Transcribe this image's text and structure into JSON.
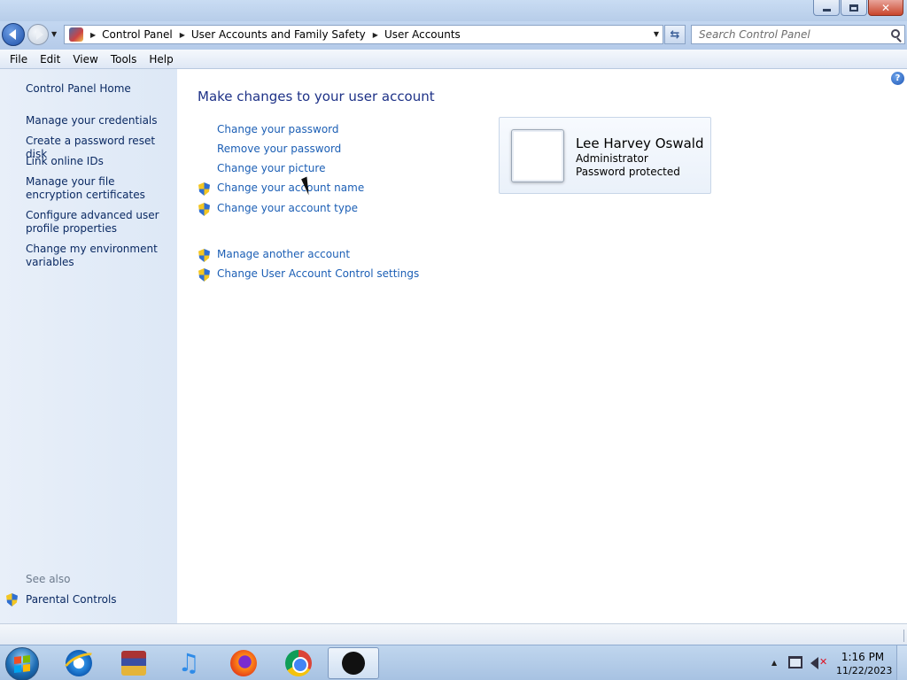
{
  "address": {
    "breadcrumbs": [
      "Control Panel",
      "User Accounts and Family Safety",
      "User Accounts"
    ]
  },
  "search": {
    "placeholder": "Search Control Panel"
  },
  "menu": [
    "File",
    "Edit",
    "View",
    "Tools",
    "Help"
  ],
  "sidebar": {
    "home": "Control Panel Home",
    "links": [
      "Manage your credentials",
      "Create a password reset disk",
      "Link online IDs",
      "Manage your file encryption certificates",
      "Configure advanced user profile properties",
      "Change my environment variables"
    ],
    "see_also": "See also",
    "parental_controls": "Parental Controls"
  },
  "main": {
    "title": "Make changes to your user account",
    "tasks": [
      "Change your password",
      "Remove your password",
      "Change your picture",
      "Change your account name",
      "Change your account type"
    ],
    "other_tasks": [
      "Manage another account",
      "Change User Account Control settings"
    ]
  },
  "account": {
    "name": "Lee Harvey Oswald",
    "role": "Administrator",
    "status": "Password protected"
  },
  "taskbar": {
    "time": "1:16 PM",
    "date": "11/22/2023"
  }
}
